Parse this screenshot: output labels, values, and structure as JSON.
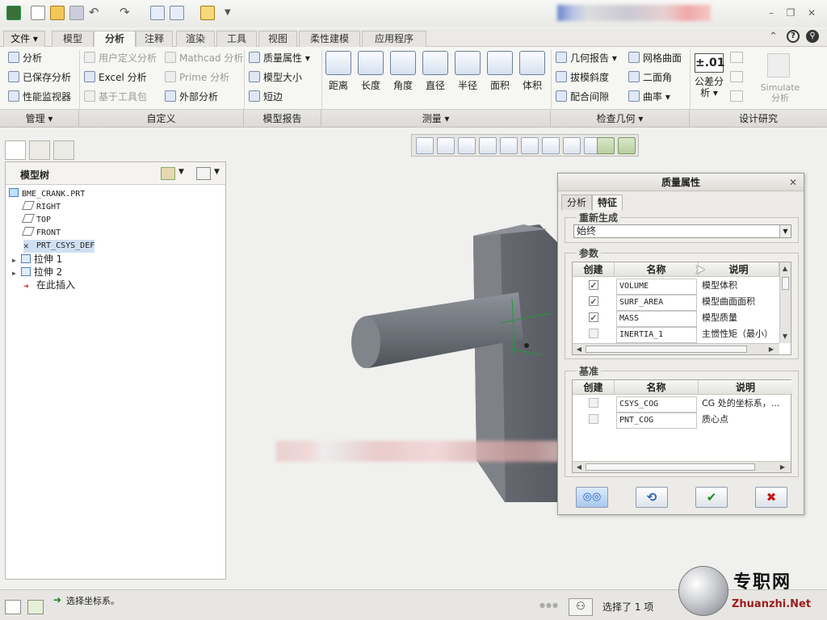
{
  "ribbon": {
    "tabs": [
      "文件",
      "模型",
      "分析",
      "注释",
      "渲染",
      "工具",
      "视图",
      "柔性建模",
      "应用程序"
    ],
    "manage": {
      "analysis": "分析",
      "saved_analysis": "已保存分析",
      "performance_monitor": "性能监视器"
    },
    "custom": {
      "user_defined": "用户定义分析",
      "mathcad": "Mathcad 分析",
      "excel": "Excel 分析",
      "prime": "Prime 分析",
      "toolkit": "基于工具包",
      "external": "外部分析"
    },
    "model_report": {
      "mass_props": "质量属性",
      "model_size": "模型大小",
      "short_edge": "短边"
    },
    "measure": [
      "距离",
      "长度",
      "角度",
      "直径",
      "半径",
      "面积",
      "体积"
    ],
    "inspect": {
      "geom_report": "几何报告",
      "draft": "拔模斜度",
      "clearance": "配合间隙",
      "mesh_surface": "网格曲面",
      "dihedral": "二面角",
      "curvature": "曲率"
    },
    "design": {
      "tolerance_value": "±.01",
      "tolerance_label_1": "公差分",
      "tolerance_label_2": "析",
      "simulate_1": "Simulate",
      "simulate_2": "分析"
    },
    "groups": [
      "管理",
      "自定义",
      "模型报告",
      "测量",
      "检查几何",
      "设计研究"
    ]
  },
  "tree": {
    "title": "模型树",
    "items": [
      "BME_CRANK.PRT",
      "RIGHT",
      "TOP",
      "FRONT",
      "PRT_CSYS_DEF",
      "拉伸 1",
      "拉伸 2",
      "在此插入"
    ]
  },
  "dialog": {
    "title": "质量属性",
    "tabs": [
      "分析",
      "特征"
    ],
    "regen_label": "重新生成",
    "regen_value": "始终",
    "params_label": "参数",
    "datum_label": "基准",
    "col_create": "创建",
    "col_name": "名称",
    "col_desc": "说明",
    "params": [
      {
        "checked": true,
        "name": "VOLUME",
        "desc": "模型体积"
      },
      {
        "checked": true,
        "name": "SURF_AREA",
        "desc": "模型曲面面积"
      },
      {
        "checked": true,
        "name": "MASS",
        "desc": "模型质量"
      },
      {
        "checked": false,
        "name": "INERTIA_1",
        "desc": "主惯性矩（最小）"
      }
    ],
    "datums": [
      {
        "checked": false,
        "name": "CSYS_COG",
        "desc": "CG 处的坐标系，..."
      },
      {
        "checked": false,
        "name": "PNT_COG",
        "desc": "质心点"
      }
    ]
  },
  "status": {
    "message": "选择坐标系。",
    "selection": "选择了 1 项"
  },
  "watermark": {
    "cn": "专职网",
    "url": "Zhuanzhi.Net"
  },
  "colors": {
    "accent": "#2b63b5",
    "ok": "#1f8a1f",
    "cancel": "#c8191a"
  }
}
